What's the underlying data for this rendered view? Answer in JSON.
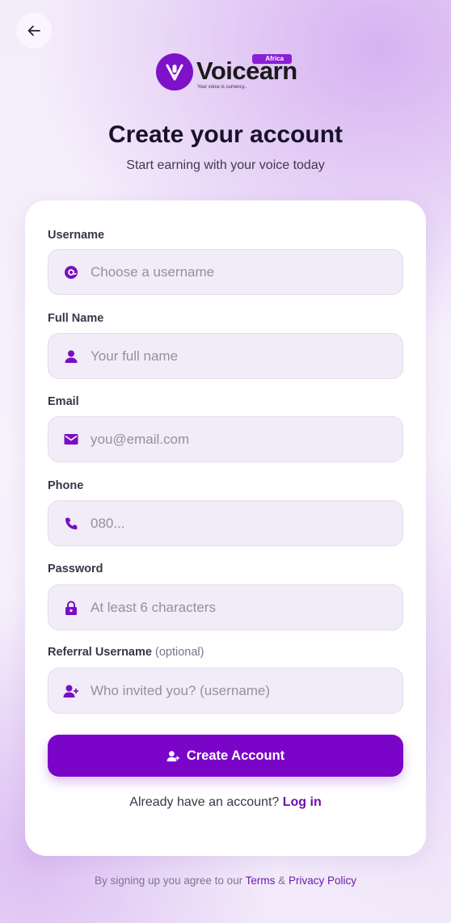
{
  "header": {
    "back_icon": "arrow-left-icon"
  },
  "brand": {
    "name": "Voicearn",
    "badge": "Africa",
    "tagline": "Your voice is currency..",
    "logo_color": "#7d12c9"
  },
  "page": {
    "title": "Create your account",
    "subtitle": "Start earning with your voice today"
  },
  "form": {
    "username": {
      "label": "Username",
      "placeholder": "Choose a username",
      "value": "",
      "icon": "at-sign-icon"
    },
    "full_name": {
      "label": "Full Name",
      "placeholder": "Your full name",
      "value": "",
      "icon": "person-icon"
    },
    "email": {
      "label": "Email",
      "placeholder": "you@email.com",
      "value": "",
      "icon": "mail-icon"
    },
    "phone": {
      "label": "Phone",
      "placeholder": "080...",
      "value": "",
      "icon": "phone-icon"
    },
    "password": {
      "label": "Password",
      "placeholder": "At least 6 characters",
      "value": "",
      "icon": "lock-icon"
    },
    "referral": {
      "label": "Referral Username",
      "optional": "(optional)",
      "placeholder": "Who invited you? (username)",
      "value": "",
      "icon": "person-add-icon"
    },
    "submit_label": "Create Account",
    "submit_icon": "person-add-icon"
  },
  "login": {
    "prompt": "Already have an account?",
    "link": "Log in"
  },
  "footer": {
    "prefix": "By signing up you agree to our",
    "terms": "Terms",
    "amp": "&",
    "privacy": "Privacy Policy"
  },
  "colors": {
    "accent": "#7a05c8",
    "icon": "#7a0fc2",
    "field_bg": "#f1ecf7"
  }
}
